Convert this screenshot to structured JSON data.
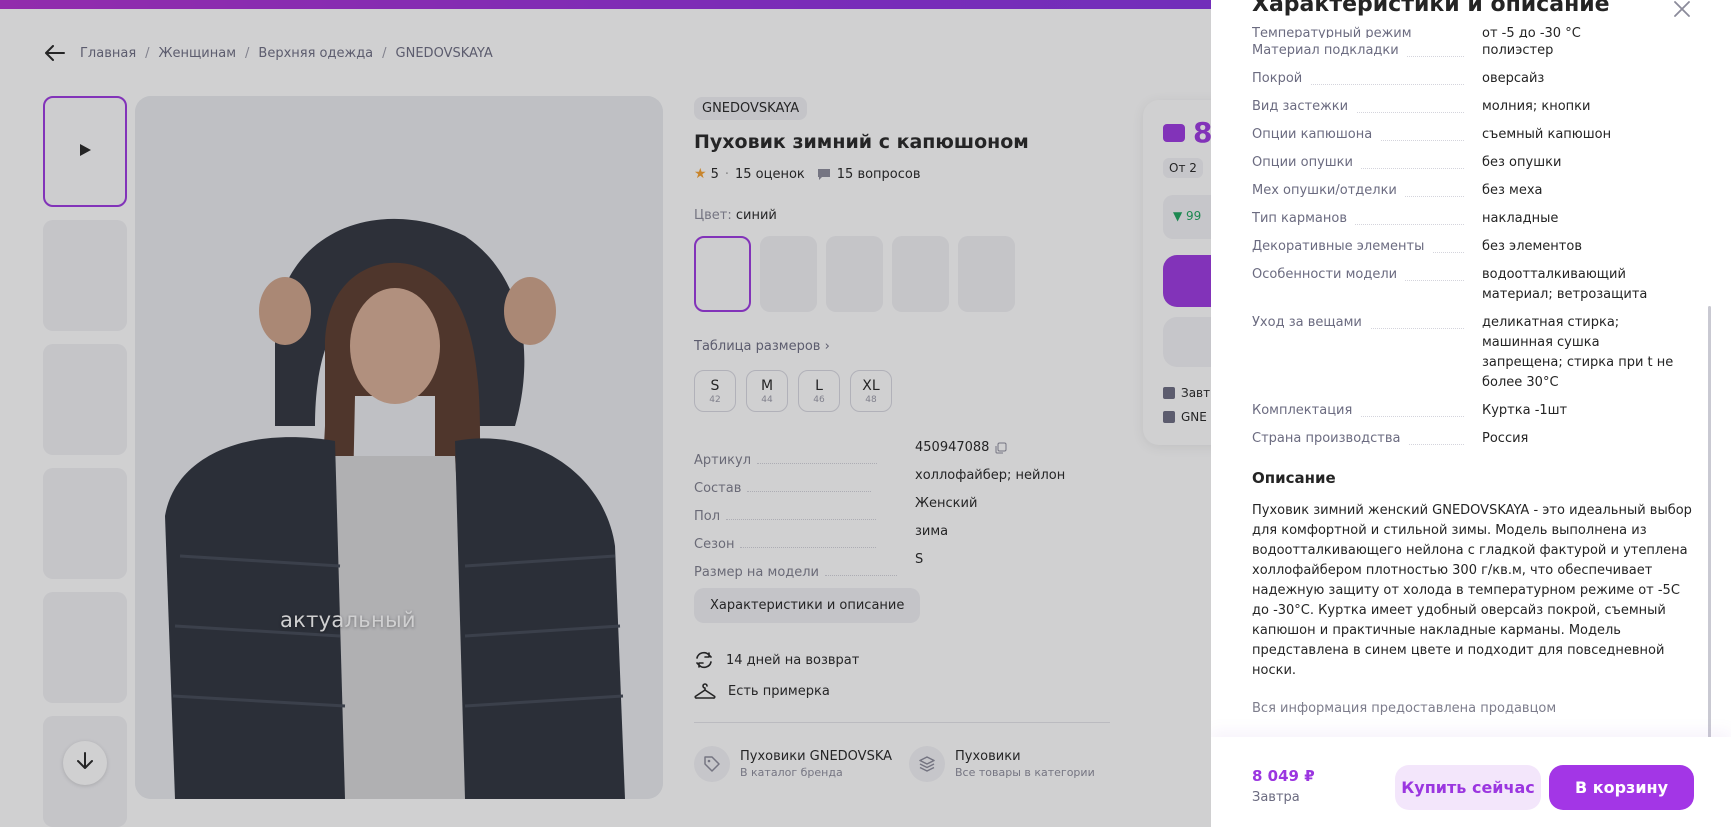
{
  "breadcrumb": {
    "items": [
      "Главная",
      "Женщинам",
      "Верхняя одежда",
      "GNEDOVSKAYA"
    ]
  },
  "photo": {
    "caption": "актуальный"
  },
  "product": {
    "brand": "GNEDOVSKAYA",
    "title": "Пуховик зимний с капюшоном",
    "rating": "5",
    "reviews": "15 оценок",
    "questions": "15 вопросов",
    "color_label": "Цвет:",
    "color_value": "синий",
    "size_table_link": "Таблица размеров",
    "sizes": [
      {
        "label": "S",
        "sub": "42"
      },
      {
        "label": "M",
        "sub": "44"
      },
      {
        "label": "L",
        "sub": "46"
      },
      {
        "label": "XL",
        "sub": "48"
      }
    ],
    "params": [
      {
        "key": "Артикул",
        "value": "450947088"
      },
      {
        "key": "Состав",
        "value": "холлофайбер; нейлон"
      },
      {
        "key": "Пол",
        "value": "Женский"
      },
      {
        "key": "Сезон",
        "value": "зима"
      },
      {
        "key": "Размер на модели",
        "value": "S"
      }
    ],
    "char_button": "Характеристики и описание",
    "features": [
      "14 дней на возврат",
      "Есть примерка"
    ],
    "categories": [
      {
        "title": "Пуховики GNEDOVSKA",
        "sub": "В каталог бренда"
      },
      {
        "title": "Пуховики",
        "sub": "Все товары в категории"
      }
    ]
  },
  "price_card": {
    "price": "8",
    "badge": "От 2",
    "green": "▼ 99",
    "line1": "Завт",
    "line2": "GNE"
  },
  "drawer": {
    "title": "Характеристики и описание",
    "cut_row": {
      "key": "Температурный режим",
      "value": "от -5 до -30 °С"
    },
    "specs": [
      {
        "key": "Материал подкладки",
        "value": "полиэстер"
      },
      {
        "key": "Покрой",
        "value": "оверсайз"
      },
      {
        "key": "Вид застежки",
        "value": "молния; кнопки"
      },
      {
        "key": "Опции капюшона",
        "value": "съемный капюшон"
      },
      {
        "key": "Опции опушки",
        "value": "без опушки"
      },
      {
        "key": "Мех опушки/отделки",
        "value": "без меха"
      },
      {
        "key": "Тип карманов",
        "value": "накладные"
      },
      {
        "key": "Декоративные элементы",
        "value": "без элементов"
      },
      {
        "key": "Особенности модели",
        "value": "водоотталкивающий материал; ветрозащита"
      },
      {
        "key": "Уход за вещами",
        "value": "деликатная стирка; машинная сушка запрещена; стирка при t не более 30°C"
      },
      {
        "key": "Комплектация",
        "value": "Куртка -1шт"
      },
      {
        "key": "Страна производства",
        "value": "Россия"
      }
    ],
    "description_title": "Описание",
    "description": "Пуховик зимний женский GNEDOVSKAYA - это идеальный выбор для комфортной и стильной зимы. Модель выполнена из водоотталкивающего нейлона с гладкой фактурой и утеплена холлофайбером плотностью 300 г/кв.м, что обеспечивает надежную защиту от холода в температурном режиме от -5С до -30°C. Куртка имеет удобный оверсайз покрой, съемный капюшон и практичные накладные карманы. Модель представлена в синем цвете и подходит для повседневной носки.",
    "note": "Вся информация предоставлена продавцом",
    "footer": {
      "price": "8 049 ₽",
      "date": "Завтра",
      "buy_now": "Купить сейчас",
      "add_to_cart": "В корзину"
    }
  },
  "colors": {
    "accent": "#9b36e0",
    "accent_light": "#f3e6fb",
    "rating_star": "#f59f2d"
  }
}
